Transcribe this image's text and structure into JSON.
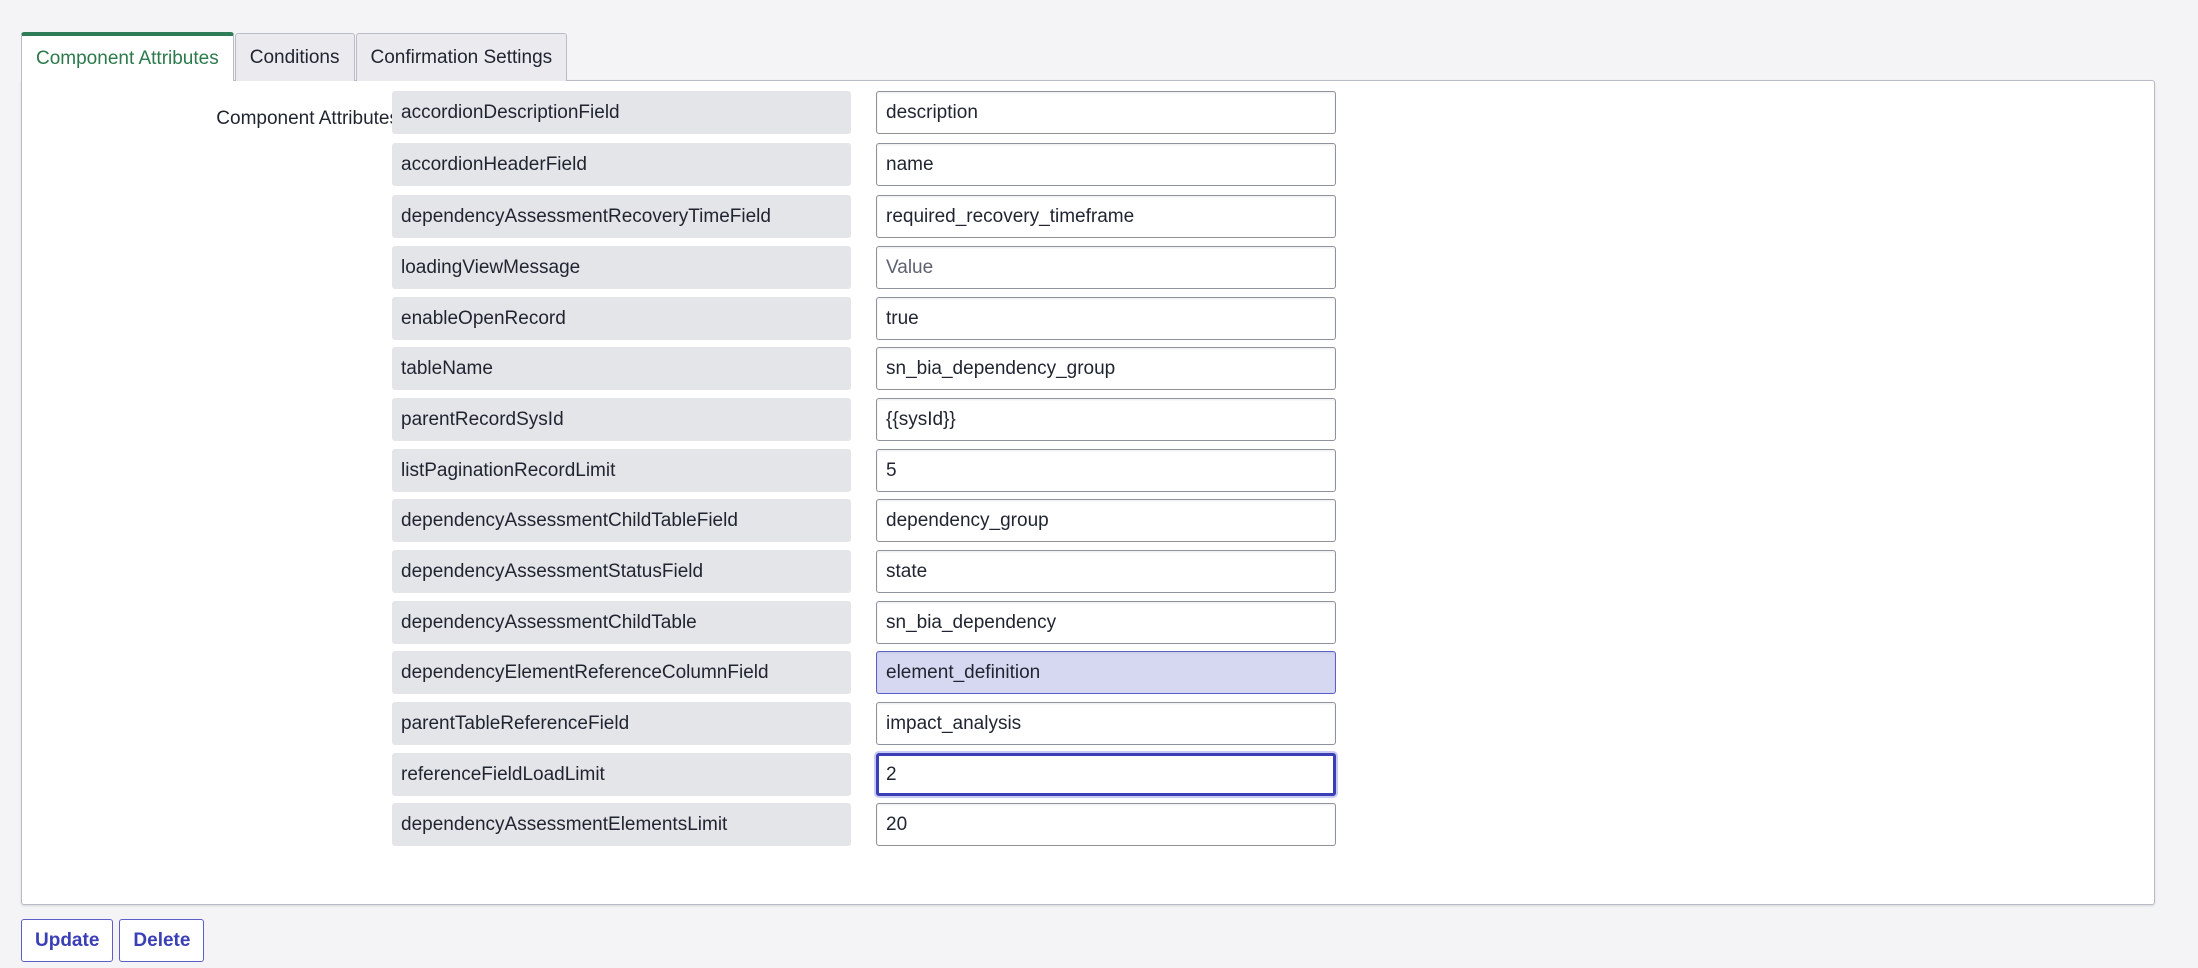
{
  "tabs": [
    {
      "label": "Component Attributes",
      "active": true
    },
    {
      "label": "Conditions",
      "active": false
    },
    {
      "label": "Confirmation Settings",
      "active": false
    }
  ],
  "section_label": "Component Attributes",
  "attributes": [
    {
      "name": "accordionDescriptionField",
      "value": "description"
    },
    {
      "name": "accordionHeaderField",
      "value": "name"
    },
    {
      "name": "dependencyAssessmentRecoveryTimeField",
      "value": "required_recovery_timeframe"
    },
    {
      "name": "loadingViewMessage",
      "value": "",
      "placeholder": "Value"
    },
    {
      "name": "enableOpenRecord",
      "value": "true"
    },
    {
      "name": "tableName",
      "value": "sn_bia_dependency_group"
    },
    {
      "name": "parentRecordSysId",
      "value": "{{sysId}}"
    },
    {
      "name": "listPaginationRecordLimit",
      "value": "5"
    },
    {
      "name": "dependencyAssessmentChildTableField",
      "value": "dependency_group"
    },
    {
      "name": "dependencyAssessmentStatusField",
      "value": "state"
    },
    {
      "name": "dependencyAssessmentChildTable",
      "value": "sn_bia_dependency"
    },
    {
      "name": "dependencyElementReferenceColumnField",
      "value": "element_definition",
      "state": "highlighted"
    },
    {
      "name": "parentTableReferenceField",
      "value": "impact_analysis"
    },
    {
      "name": "referenceFieldLoadLimit",
      "value": "2",
      "state": "focused"
    },
    {
      "name": "dependencyAssessmentElementsLimit",
      "value": "20"
    }
  ],
  "buttons": {
    "update_label": "Update",
    "delete_label": "Delete"
  },
  "colors": {
    "active_tab_accent": "#2e7d57",
    "button_accent": "#3b3fb5",
    "highlight_fill": "#d6d8f1"
  }
}
